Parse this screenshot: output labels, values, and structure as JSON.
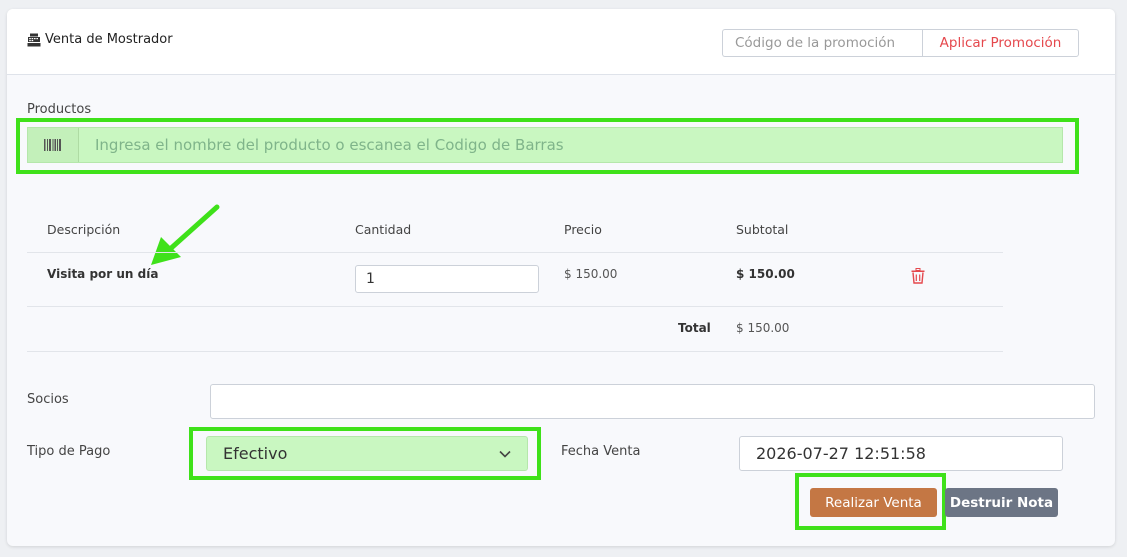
{
  "header": {
    "title": "Venta de Mostrador",
    "promo_placeholder": "Código de la promoción",
    "promo_button": "Aplicar Promoción"
  },
  "products": {
    "label": "Productos",
    "search_placeholder": "Ingresa el nombre del producto o escanea el Codigo de Barras"
  },
  "table": {
    "headers": {
      "description": "Descripción",
      "quantity": "Cantidad",
      "price": "Precio",
      "subtotal": "Subtotal"
    },
    "rows": [
      {
        "description": "Visita por un día",
        "quantity": "1",
        "price": "$ 150.00",
        "subtotal": "$ 150.00"
      }
    ],
    "total_label": "Total",
    "total_value": "$ 150.00"
  },
  "form": {
    "socios_label": "Socios",
    "socios_value": "",
    "tipo_pago_label": "Tipo de Pago",
    "tipo_pago_value": "Efectivo",
    "fecha_label": "Fecha Venta",
    "fecha_value": "2026-07-27 12:51:58"
  },
  "actions": {
    "realizar": "Realizar Venta",
    "destruir": "Destruir Nota"
  },
  "colors": {
    "highlight": "#3fe11a",
    "highlight_fill": "#c9f7c1",
    "danger": "#e5484d",
    "primary_button": "#c47744",
    "secondary_button": "#6c7585"
  }
}
